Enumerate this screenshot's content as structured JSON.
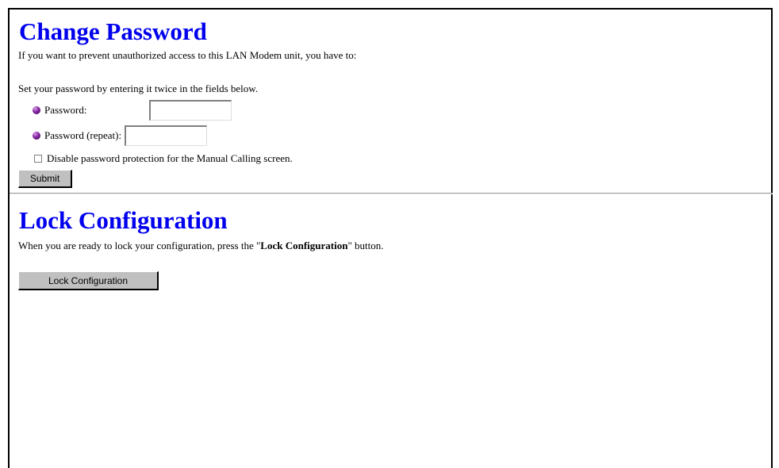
{
  "change_password": {
    "title": "Change Password",
    "intro": "If you want to prevent unauthorized access to this LAN Modem unit, you have to:",
    "instruction": "Set your password by entering it twice in the fields below.",
    "password_label": "Password:",
    "password_value": "",
    "password_repeat_label": "Password (repeat):",
    "password_repeat_value": "",
    "disable_checkbox_label": "Disable password protection for the Manual Calling screen.",
    "disable_checkbox_checked": false,
    "submit_label": "Submit"
  },
  "lock_configuration": {
    "title": "Lock Configuration",
    "text_before": "When you are ready to lock your configuration, press the \"",
    "text_bold": "Lock Configuration",
    "text_after": "\" button.",
    "button_label": "Lock Configuration"
  },
  "colors": {
    "heading": "#0000ee",
    "button_face": "#c0c0c0",
    "bullet": "#8a2aa8"
  }
}
